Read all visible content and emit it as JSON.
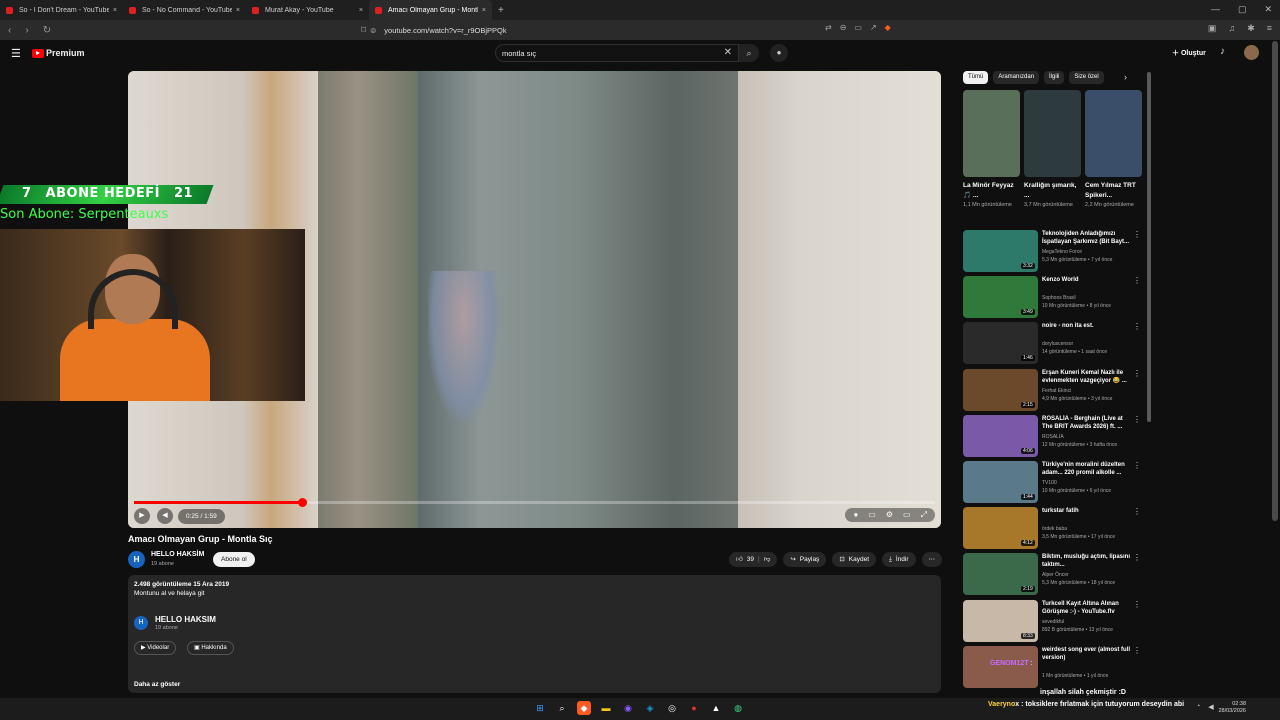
{
  "browser": {
    "tabs": [
      {
        "title": "So - I Don't Dream - YouTube",
        "active": false
      },
      {
        "title": "So - No Command - YouTube",
        "active": false
      },
      {
        "title": "Murat Akay - YouTube",
        "active": false
      },
      {
        "title": "Amacı Olmayan Grup - Montla Sıç",
        "active": true
      }
    ],
    "url": "youtube.com/watch?v=r_r9OBjPPQk"
  },
  "header": {
    "logo": "Premium",
    "search_value": "montla sıç",
    "create_label": "Oluştur"
  },
  "overlay": {
    "abone_current": "7",
    "abone_label": "ABONE HEDEFİ",
    "abone_goal": "21",
    "son_abone": "Son Abone: Serpenteauxs"
  },
  "player": {
    "time": "0:25 / 1:59",
    "progress": 0.21
  },
  "video": {
    "title": "Amacı Olmayan Grup - Montla Sıç",
    "channel": "HELLO HAKSİM",
    "subscribers": "19 abone",
    "subscribe_label": "Abone ol",
    "likes": "39",
    "share_label": "Paylaş",
    "save_label": "Kaydet",
    "download_label": "İndir",
    "views_date": "2.498 görüntüleme  15 Ara 2019",
    "description": "Montunu al ve helaya git",
    "desc_channel": "HELLO HAKSIM",
    "desc_subs": "19 abone",
    "videos_label": "Videolar",
    "about_label": "Hakkında",
    "more_label": "Daha az göster"
  },
  "sidebar": {
    "chips": [
      "Tümü",
      "Aramanızdan",
      "İlgili",
      "Size özel"
    ],
    "shorts": [
      {
        "title": "La Minör Feyyaz 🎵 ...",
        "views": "1,1 Mn görüntüleme",
        "color": "#5a6f5a"
      },
      {
        "title": "Kralliğın şımarık, ...",
        "views": "3,7 Mn görüntüleme",
        "color": "#2d3a3e"
      },
      {
        "title": "Cem Yılmaz TRT Spikeri...",
        "views": "2,2 Mn görüntüleme",
        "color": "#3a4e6a"
      }
    ],
    "recommendations": [
      {
        "title": "Teknolojiden Anladığımızı İspatlayan Şarkımız (Bit Bayt...",
        "channel": "MegaTekno Force",
        "meta": "5,3 Mn görüntüleme • 7 yıl önce",
        "duration": "3:32",
        "color": "#2e7a6a"
      },
      {
        "title": "Kenzo World",
        "channel": "Sophoos Brasil",
        "meta": "10 Mn görüntüleme • 8 yıl önce",
        "duration": "3:49",
        "color": "#2f7a3a"
      },
      {
        "title": "noire - non ita est.",
        "channel": "doryluscensor",
        "meta": "14 görüntüleme • 1 saat önce",
        "duration": "1:46",
        "color": "#2a2a2a"
      },
      {
        "title": "Erşan Kuneri Kemal Nazlı ile evlenmekten vazgeçiyor 😂 ...",
        "channel": "Ferhat Ekinci",
        "meta": "4,9 Mn görüntüleme • 3 yıl önce",
        "duration": "2:15",
        "color": "#6a4a2a"
      },
      {
        "title": "ROSALÍA - Berghain (Live at The BRIT Awards 2026) ft. ...",
        "channel": "ROSALÍA",
        "meta": "12 Mn görüntüleme • 3 hafta önce",
        "duration": "4:06",
        "color": "#7a5aa8"
      },
      {
        "title": "Türkiye'nin moralini düzelten adam... 220 promil alkolle ...",
        "channel": "TV100",
        "meta": "10 Mn görüntüleme • 6 yıl önce",
        "duration": "1:44",
        "color": "#5a7a8a"
      },
      {
        "title": "turkstar fatih",
        "channel": "ördek baba",
        "meta": "3,5 Mn görüntüleme • 17 yıl önce",
        "duration": "4:12",
        "color": "#a8782a"
      },
      {
        "title": "Biktım, musluğu açtım, lipasını taktım...",
        "channel": "Alper Öncer",
        "meta": "5,3 Mn görüntüleme • 18 yıl önce",
        "duration": "2:19",
        "color": "#3a6a4a"
      },
      {
        "title": "Turkcell Kayıt Altına Alınan Görüşme :-) - YouTube.flv",
        "channel": "sevedikful",
        "meta": "892 B görüntüleme • 13 yıl önce",
        "duration": "8:33",
        "color": "#c8b8a8"
      },
      {
        "title": "weirdest song ever (almost full version)",
        "channel": "",
        "meta": "1 Mn görüntüleme • 1 yıl önce",
        "duration": "",
        "color": "#8a5a4a"
      }
    ]
  },
  "chat": {
    "user1": "GENOM12T",
    "msg2": "inşallah silah çekmiştir :D",
    "notif_user": "Vaeryno",
    "notif_msg": "x : toksiklere fırlatmak için tutuyorum deseydin abi"
  },
  "taskbar": {
    "time": "02:38",
    "date": "28/03/2026"
  },
  "colors": {
    "accent": "#ff0000",
    "overlay_green": "#33d045"
  }
}
